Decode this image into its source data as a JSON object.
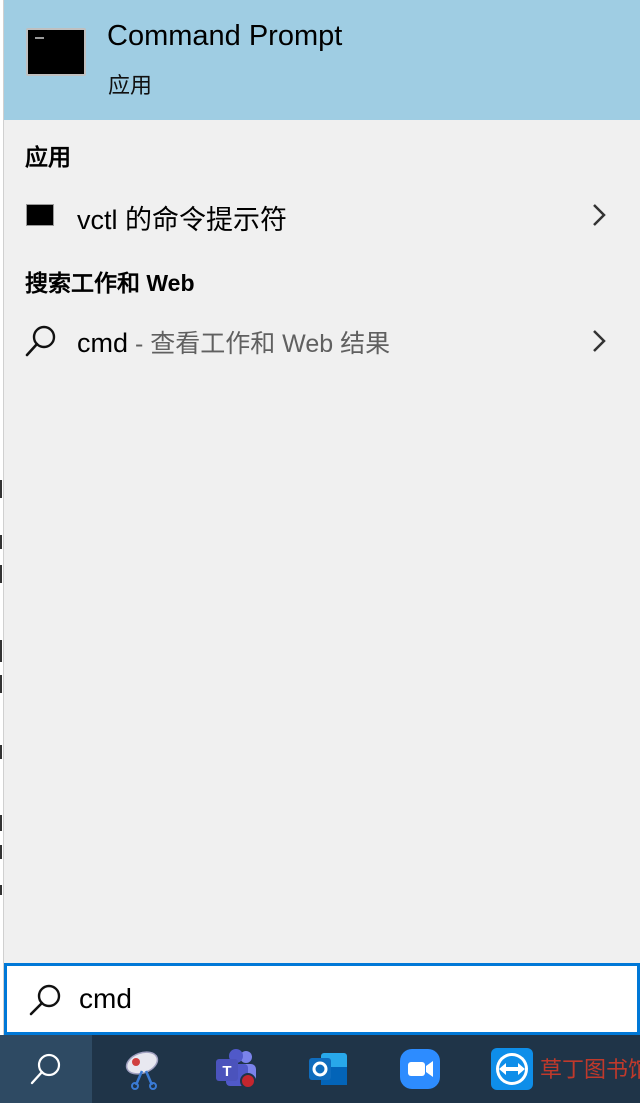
{
  "best_match": {
    "title": "Command Prompt",
    "subtitle": "应用",
    "icon": "cmd-icon",
    "bg_color": "#9fcde3"
  },
  "sections": {
    "apps_header": "应用",
    "web_header": "搜索工作和 Web"
  },
  "apps_results": [
    {
      "label": "vctl 的命令提示符",
      "icon": "cmd-icon"
    }
  ],
  "web_results": [
    {
      "query": "cmd",
      "suffix": " - 查看工作和 Web 结果",
      "icon": "search-icon"
    }
  ],
  "search": {
    "value": "cmd",
    "accent": "#0078d7"
  },
  "taskbar": {
    "bg_color": "#1f3448",
    "items": [
      {
        "icon": "search-icon"
      },
      {
        "icon": "snipping-tool-icon"
      },
      {
        "icon": "teams-icon"
      },
      {
        "icon": "outlook-icon"
      },
      {
        "icon": "zoom-icon"
      },
      {
        "icon": "teamviewer-icon"
      }
    ]
  },
  "watermark": {
    "text": "草丁图书馆"
  }
}
